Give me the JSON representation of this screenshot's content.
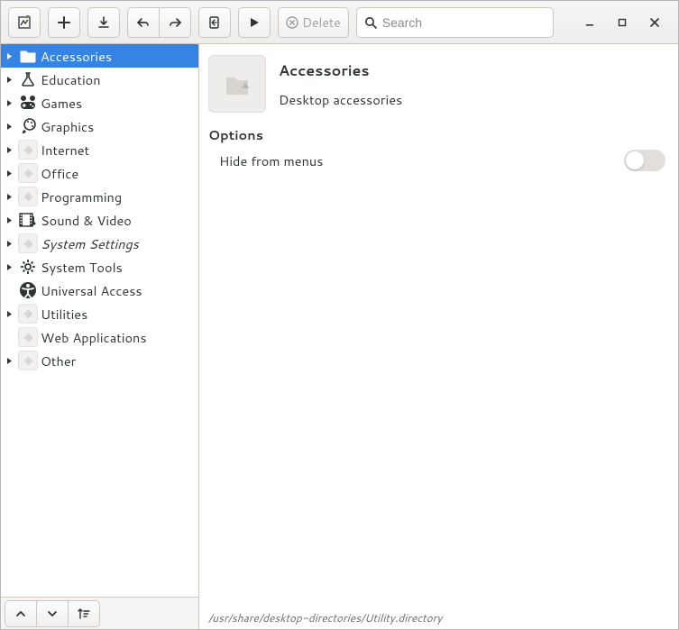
{
  "toolbar": {
    "delete_label": "Delete"
  },
  "search": {
    "placeholder": "Search",
    "value": ""
  },
  "categories": [
    {
      "name": "Accessories",
      "icon": "folder",
      "selected": true,
      "expandable": true,
      "italic": false
    },
    {
      "name": "Education",
      "icon": "flask",
      "selected": false,
      "expandable": true,
      "italic": false
    },
    {
      "name": "Games",
      "icon": "gamepad",
      "selected": false,
      "expandable": true,
      "italic": false
    },
    {
      "name": "Graphics",
      "icon": "brush",
      "selected": false,
      "expandable": true,
      "italic": false
    },
    {
      "name": "Internet",
      "icon": "placeholder",
      "selected": false,
      "expandable": true,
      "italic": false
    },
    {
      "name": "Office",
      "icon": "placeholder",
      "selected": false,
      "expandable": true,
      "italic": false
    },
    {
      "name": "Programming",
      "icon": "placeholder",
      "selected": false,
      "expandable": true,
      "italic": false
    },
    {
      "name": "Sound & Video",
      "icon": "media",
      "selected": false,
      "expandable": true,
      "italic": false
    },
    {
      "name": "System Settings",
      "icon": "placeholder",
      "selected": false,
      "expandable": true,
      "italic": true
    },
    {
      "name": "System Tools",
      "icon": "gear",
      "selected": false,
      "expandable": true,
      "italic": false
    },
    {
      "name": "Universal Access",
      "icon": "accessibility",
      "selected": false,
      "expandable": false,
      "italic": false
    },
    {
      "name": "Utilities",
      "icon": "placeholder",
      "selected": false,
      "expandable": true,
      "italic": false
    },
    {
      "name": "Web Applications",
      "icon": "placeholder",
      "selected": false,
      "expandable": false,
      "italic": false
    },
    {
      "name": "Other",
      "icon": "placeholder",
      "selected": false,
      "expandable": true,
      "italic": false
    }
  ],
  "details": {
    "title": "Accessories",
    "subtitle": "Desktop accessories",
    "options_heading": "Options",
    "hide_label": "Hide from menus",
    "hide_value": false
  },
  "status": "/usr/share/desktop-directories/Utility.directory"
}
